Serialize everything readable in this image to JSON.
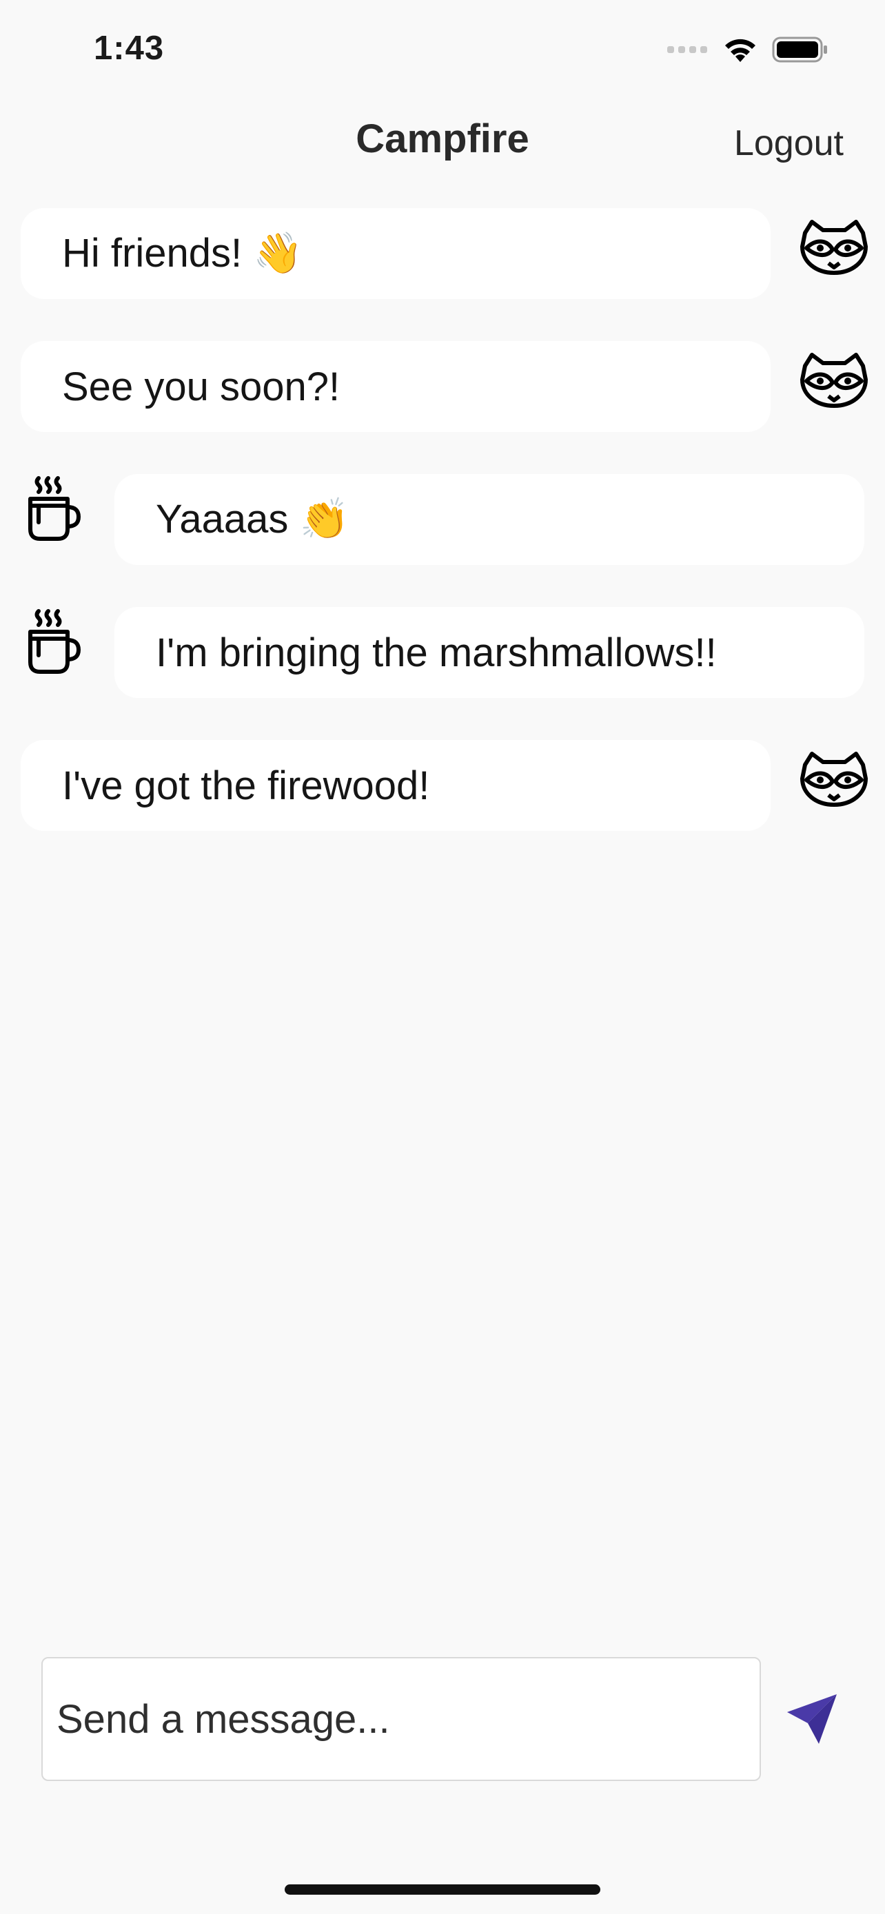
{
  "status_bar": {
    "time": "1:43"
  },
  "nav": {
    "title": "Campfire",
    "logout_label": "Logout"
  },
  "messages": [
    {
      "text": "Hi friends! 👋",
      "sender": "mine",
      "avatar": "raccoon-icon"
    },
    {
      "text": "See you soon?!",
      "sender": "mine",
      "avatar": "raccoon-icon"
    },
    {
      "text": "Yaaaas 👏",
      "sender": "theirs",
      "avatar": "hot-mug-icon"
    },
    {
      "text": "I'm bringing the marshmallows!!",
      "sender": "theirs",
      "avatar": "hot-mug-icon"
    },
    {
      "text": "I've got the firewood!",
      "sender": "mine",
      "avatar": "raccoon-icon"
    }
  ],
  "composer": {
    "placeholder": "Send a message...",
    "value": ""
  },
  "colors": {
    "accent": "#4a3aa8",
    "background": "#f9f9f9",
    "bubble": "#ffffff"
  }
}
